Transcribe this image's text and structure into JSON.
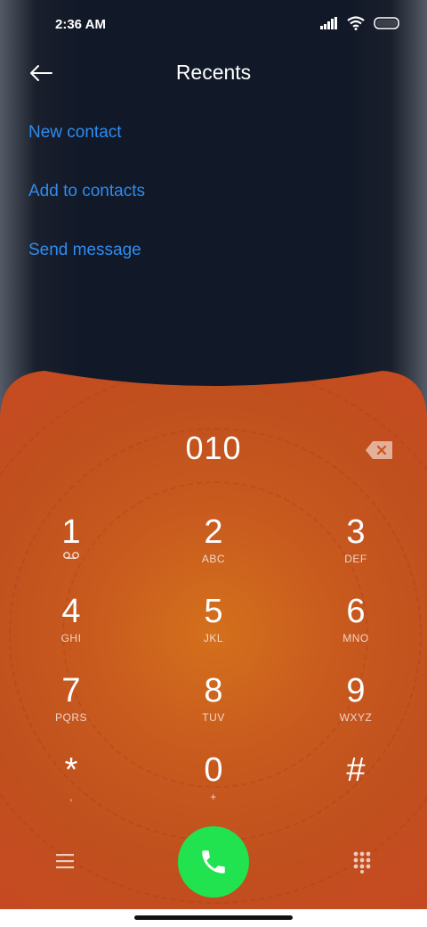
{
  "status_bar": {
    "time": "2:36 AM",
    "icons": [
      "signal-icon",
      "wifi-icon",
      "battery-icon"
    ]
  },
  "header": {
    "title": "Recents",
    "back_icon": "back-arrow-icon"
  },
  "actions": [
    {
      "label": "New contact"
    },
    {
      "label": "Add to contacts"
    },
    {
      "label": "Send message"
    }
  ],
  "dialer": {
    "entered_number": "010",
    "keys": [
      {
        "digit": "1",
        "letters": ""
      },
      {
        "digit": "2",
        "letters": "ABC"
      },
      {
        "digit": "3",
        "letters": "DEF"
      },
      {
        "digit": "4",
        "letters": "GHI"
      },
      {
        "digit": "5",
        "letters": "JKL"
      },
      {
        "digit": "6",
        "letters": "MNO"
      },
      {
        "digit": "7",
        "letters": "PQRS"
      },
      {
        "digit": "8",
        "letters": "TUV"
      },
      {
        "digit": "9",
        "letters": "WXYZ"
      },
      {
        "digit": "*",
        "letters": ","
      },
      {
        "digit": "0",
        "letters": "+"
      },
      {
        "digit": "#",
        "letters": ""
      }
    ]
  },
  "colors": {
    "link": "#2f8cf0",
    "call_button": "#21e34f",
    "dialer_bg": "#c8561e",
    "top_bg": "#111827"
  }
}
